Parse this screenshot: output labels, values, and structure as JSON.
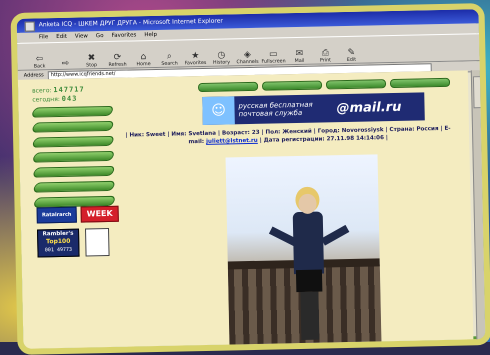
{
  "window": {
    "title": "Anketa ICQ - ШКЕМ ДРУГ ДРУГА - Microsoft Internet Explorer"
  },
  "menu": [
    "File",
    "Edit",
    "View",
    "Go",
    "Favorites",
    "Help"
  ],
  "toolbar": [
    {
      "label": "Back",
      "icon": "back-arrow-icon"
    },
    {
      "label": "",
      "icon": "forward-arrow-icon"
    },
    {
      "label": "Stop",
      "icon": "stop-icon"
    },
    {
      "label": "Refresh",
      "icon": "refresh-icon"
    },
    {
      "label": "Home",
      "icon": "home-icon"
    },
    {
      "label": "Search",
      "icon": "search-icon"
    },
    {
      "label": "Favorites",
      "icon": "favorites-icon"
    },
    {
      "label": "History",
      "icon": "history-icon"
    },
    {
      "label": "Channels",
      "icon": "channels-icon"
    },
    {
      "label": "Fullscreen",
      "icon": "fullscreen-icon"
    },
    {
      "label": "Mail",
      "icon": "mail-icon"
    },
    {
      "label": "Print",
      "icon": "print-icon"
    },
    {
      "label": "Edit",
      "icon": "edit-icon"
    }
  ],
  "address": {
    "label": "Address",
    "value": "http://www.icqfriends.net/"
  },
  "counters": {
    "visits_label": "всего:",
    "visits": "147717",
    "today_label": "сегодня:",
    "today": "043"
  },
  "badges": {
    "rating": "Ratalrarch",
    "week": "WEEK",
    "rambler_line1": "Rambler's",
    "rambler_line2": "Top100",
    "rambler_line3": "001 49773"
  },
  "mail_banner": {
    "tagline_line1": "русская бесплатная",
    "tagline_line2": "почтовая служба",
    "brand": "@mail.ru"
  },
  "profile": {
    "line1": "| Ник: Sweet | Имя: Svetlana | Возраст: 23 | Пол: Женский | Город: Novorossiysk | Страна: Россия | E-",
    "line2_prefix": "mail: ",
    "email": "juliett@lstnet.ru",
    "line2_suffix": " | Дата регистрации: 27.11.98 14:14:06 |"
  },
  "colors": {
    "page_bg": "#f4ecc0",
    "nav_green": "#4f9a36",
    "banner_blue": "#1f2b73"
  }
}
